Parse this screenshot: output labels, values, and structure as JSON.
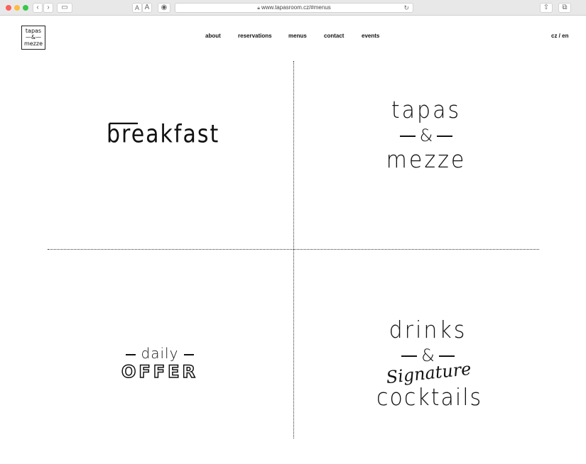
{
  "browser": {
    "url": "www.tapasroom.cz/#menus",
    "font_small_label": "A",
    "font_large_label": "A"
  },
  "logo": {
    "line1": "tapas",
    "line2": "—&—",
    "line3": "mezze"
  },
  "nav": {
    "about": "about",
    "reservations": "reservations",
    "menus": "menus",
    "contact": "contact",
    "events": "events"
  },
  "language_switch": "cz / en",
  "menus": {
    "breakfast": "breakfast",
    "tapas": {
      "top": "tapas",
      "amp": "&",
      "bottom": "mezze"
    },
    "daily": {
      "top": "daily",
      "bottom": "OFFER"
    },
    "drinks": {
      "top": "drinks",
      "amp": "&",
      "script": "Signature",
      "bottom": "cocktails"
    }
  },
  "colors": {
    "text": "#111111",
    "background": "#ffffff",
    "close": "#fc605c",
    "minimize": "#fdbc40",
    "zoom": "#34c84a"
  }
}
